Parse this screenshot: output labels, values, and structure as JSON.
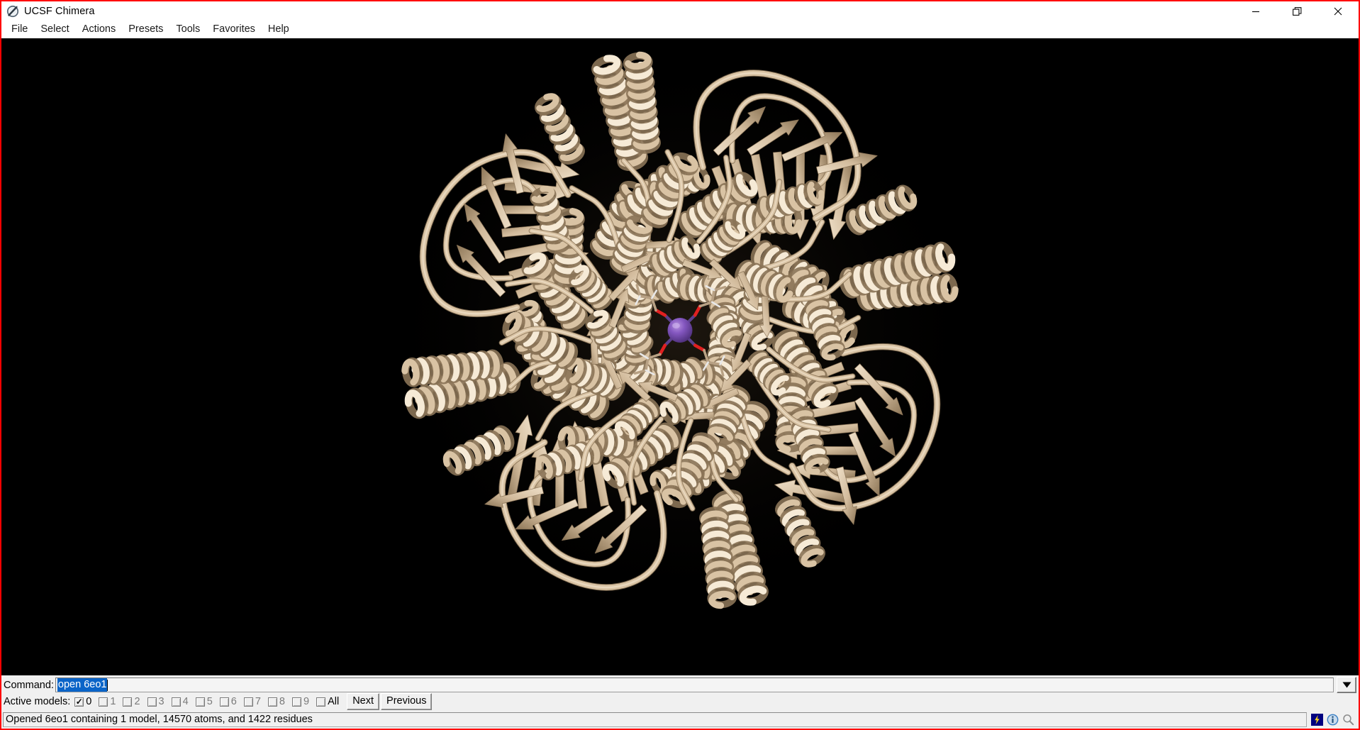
{
  "window": {
    "title": "UCSF Chimera",
    "icon": "chimera-logo-icon",
    "controls": {
      "minimize": "minimize-icon",
      "restore": "restore-icon",
      "close": "close-icon"
    }
  },
  "menubar": {
    "items": [
      {
        "label": "File"
      },
      {
        "label": "Select"
      },
      {
        "label": "Actions"
      },
      {
        "label": "Presets"
      },
      {
        "label": "Tools"
      },
      {
        "label": "Favorites"
      },
      {
        "label": "Help"
      }
    ]
  },
  "viewport": {
    "background_color": "#000000",
    "model": {
      "ribbon_color": "#d9c3a4",
      "ribbon_highlight": "#f6ead6",
      "ribbon_shadow": "#8a7356",
      "ion_color": "#7a4fb0",
      "ion_highlight": "#a87fd4",
      "bond_color": "#5a3f8c",
      "oxygen_color": "#e02020",
      "hydrogen_color": "#e8e8e8",
      "carbon_color": "#b8a184"
    }
  },
  "command": {
    "label": "Command:",
    "value": "open 6eo1",
    "selected": true,
    "selection_color": "#0a64c8",
    "dropdown_icon": "chevron-down-icon"
  },
  "active_models": {
    "label": "Active models:",
    "checkboxes": [
      {
        "id": "0",
        "label": "0",
        "checked": true
      },
      {
        "id": "1",
        "label": "1",
        "checked": false
      },
      {
        "id": "2",
        "label": "2",
        "checked": false
      },
      {
        "id": "3",
        "label": "3",
        "checked": false
      },
      {
        "id": "4",
        "label": "4",
        "checked": false
      },
      {
        "id": "5",
        "label": "5",
        "checked": false
      },
      {
        "id": "6",
        "label": "6",
        "checked": false
      },
      {
        "id": "7",
        "label": "7",
        "checked": false
      },
      {
        "id": "8",
        "label": "8",
        "checked": false
      },
      {
        "id": "9",
        "label": "9",
        "checked": false
      },
      {
        "id": "all",
        "label": "All",
        "checked": false
      }
    ],
    "next_label": "Next",
    "previous_label": "Previous"
  },
  "status": {
    "message": "Opened 6eo1 containing 1 model, 14570 atoms, and 1422 residues",
    "icons": [
      {
        "name": "lightning-icon",
        "color": "#f2d024",
        "bg": "#000080"
      },
      {
        "name": "info-icon",
        "color": "#3a7fc4"
      },
      {
        "name": "magnifier-icon",
        "color": "#808080"
      }
    ]
  }
}
